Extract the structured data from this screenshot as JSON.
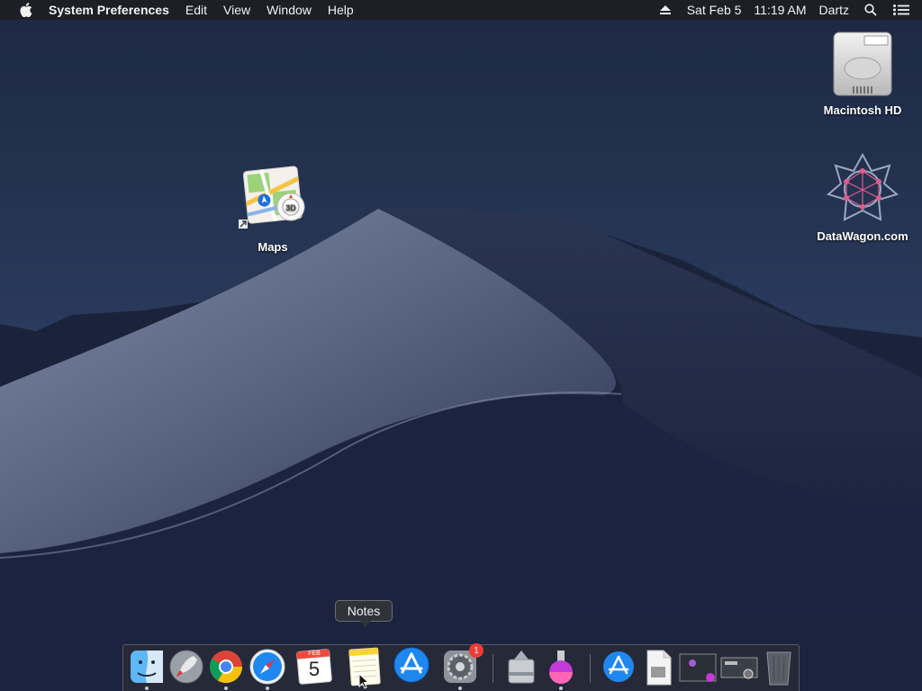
{
  "menubar": {
    "app_name": "System Preferences",
    "menus": [
      "Edit",
      "View",
      "Window",
      "Help"
    ],
    "date": "Sat Feb 5",
    "time": "11:19 AM",
    "user": "Dartz"
  },
  "desktop_icons": {
    "maps": "Maps",
    "macintosh_hd": "Macintosh HD",
    "datawagon": "DataWagon.com"
  },
  "tooltip": "Notes",
  "dock": {
    "calendar_month": "FEB",
    "calendar_day": "5",
    "system_prefs_badge": "1",
    "items": [
      "Finder",
      "Launchpad",
      "Google Chrome",
      "Safari",
      "Calendar",
      "Notes",
      "App Store",
      "System Preferences",
      "Disk Utility",
      "Installer",
      "App Store",
      "Document",
      "Screenshot",
      "Preview",
      "Trash"
    ]
  },
  "colors": {
    "menubar": "#1c1e24",
    "badge": "#ee3b35",
    "accent_blue": "#1e88f0"
  }
}
